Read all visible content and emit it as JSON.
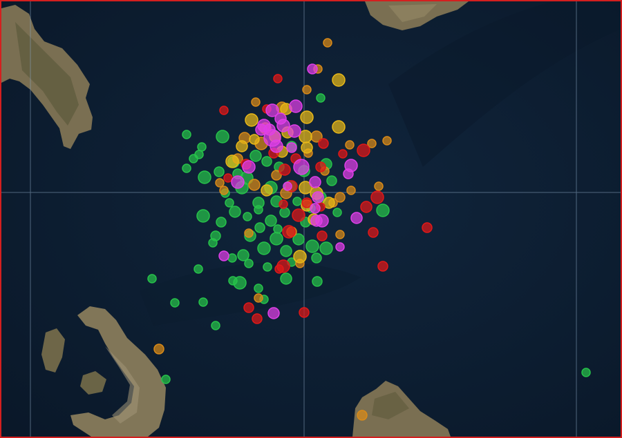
{
  "map": {
    "type": "seismic-activity",
    "base_layer": "satellite",
    "colors": {
      "sea": "#0d1f33",
      "sea_dark": "#0a1829",
      "land": "#7d7256",
      "land_dark": "#5f5a3e",
      "graticule": "#8aa4bf",
      "frame": "#d41f1f"
    },
    "marker_categories": [
      {
        "id": "green",
        "color": "#27c24a"
      },
      {
        "id": "orange",
        "color": "#d98a18"
      },
      {
        "id": "yellow",
        "color": "#e8b818"
      },
      {
        "id": "red",
        "color": "#e01818"
      },
      {
        "id": "magenta",
        "color": "#e03fe8"
      }
    ]
  }
}
